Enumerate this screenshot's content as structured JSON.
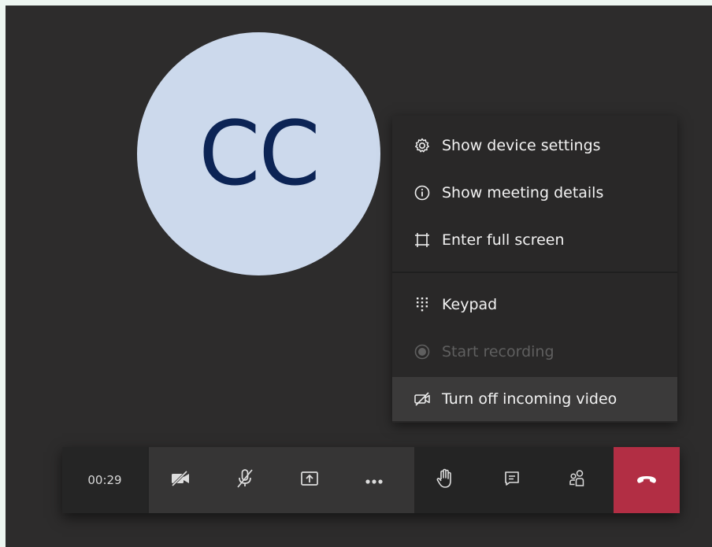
{
  "participant": {
    "initials": "CC"
  },
  "menu": {
    "items": [
      {
        "label": "Show device settings",
        "icon": "gear-icon"
      },
      {
        "label": "Show meeting details",
        "icon": "info-icon"
      },
      {
        "label": "Enter full screen",
        "icon": "fullscreen-icon"
      },
      {
        "label": "Keypad",
        "icon": "keypad-icon"
      },
      {
        "label": "Start recording",
        "icon": "record-icon",
        "disabled": true
      },
      {
        "label": "Turn off incoming video",
        "icon": "video-off-icon",
        "highlighted": true
      }
    ]
  },
  "toolbar": {
    "timer": "00:29",
    "buttons": [
      "camera-off-icon",
      "mic-muted-icon",
      "share-screen-icon",
      "more-options-icon",
      "raise-hand-icon",
      "chat-icon",
      "participants-icon",
      "hang-up-icon"
    ]
  },
  "colors": {
    "background": "#2d2c2c",
    "avatar": "#ccd9ec",
    "initials": "#0c2455",
    "hangup": "#b22e44"
  }
}
